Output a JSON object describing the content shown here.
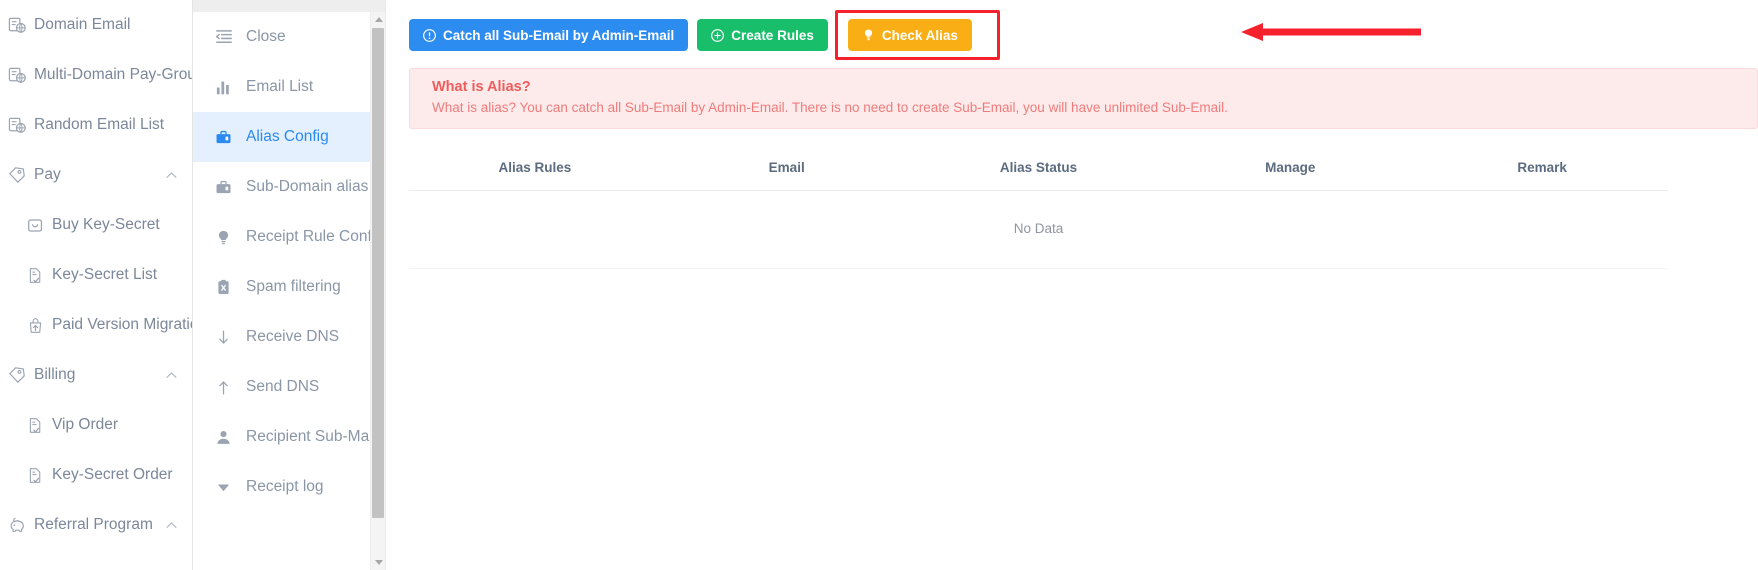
{
  "sidebar": {
    "items": [
      {
        "label": "Domain Email",
        "icon": "domain-email-icon",
        "level": "top",
        "caret": false
      },
      {
        "label": "Multi-Domain Pay-Group",
        "icon": "domain-group-icon",
        "level": "top",
        "caret": false
      },
      {
        "label": "Random Email List",
        "icon": "random-email-icon",
        "level": "top",
        "caret": false
      },
      {
        "label": "Pay",
        "icon": "pay-tag-icon",
        "level": "group",
        "caret": true
      },
      {
        "label": "Buy Key-Secret",
        "icon": "wallet-icon",
        "level": "child",
        "caret": false
      },
      {
        "label": "Key-Secret List",
        "icon": "document-check-icon",
        "level": "child",
        "caret": false
      },
      {
        "label": "Paid Version Migration",
        "icon": "upload-bag-icon",
        "level": "child",
        "caret": false
      },
      {
        "label": "Billing",
        "icon": "pay-tag-icon",
        "level": "group",
        "caret": true
      },
      {
        "label": "Vip Order",
        "icon": "document-check-icon",
        "level": "child",
        "caret": false
      },
      {
        "label": "Key-Secret Order",
        "icon": "document-check-icon",
        "level": "child",
        "caret": false
      },
      {
        "label": "Referral Program",
        "icon": "piggy-bank-icon",
        "level": "group",
        "caret": true
      }
    ]
  },
  "subnav": {
    "items": [
      {
        "label": "Close",
        "icon": "collapse-menu-icon",
        "active": false
      },
      {
        "label": "Email List",
        "icon": "bar-chart-icon",
        "active": false
      },
      {
        "label": "Alias Config",
        "icon": "briefcase-icon",
        "active": true
      },
      {
        "label": "Sub-Domain alias",
        "icon": "briefcase-icon",
        "active": false
      },
      {
        "label": "Receipt Rule Config",
        "icon": "lightbulb-icon",
        "active": false
      },
      {
        "label": "Spam filtering",
        "icon": "clipboard-x-icon",
        "active": false
      },
      {
        "label": "Receive DNS",
        "icon": "arrow-down-icon",
        "active": false
      },
      {
        "label": "Send DNS",
        "icon": "arrow-up-icon",
        "active": false
      },
      {
        "label": "Recipient Sub-Mail",
        "icon": "person-icon",
        "active": false
      },
      {
        "label": "Receipt log",
        "icon": "triangle-down-icon",
        "active": false
      }
    ]
  },
  "toolbar": {
    "catch_all_label": "Catch all Sub-Email by Admin-Email",
    "catch_all_icon": "info-circle-icon",
    "create_rules_label": "Create Rules",
    "create_rules_icon": "plus-circle-icon",
    "check_alias_label": "Check Alias",
    "check_alias_icon": "lightbulb-icon"
  },
  "alert": {
    "title": "What is Alias?",
    "description": "What is alias? You can catch all Sub-Email by Admin-Email. There is no need to create Sub-Email, you will have unlimited Sub-Email."
  },
  "table": {
    "columns": [
      "Alias Rules",
      "Email",
      "Alias Status",
      "Manage",
      "Remark"
    ],
    "rows": [],
    "empty_text": "No Data"
  },
  "annotation": {
    "type": "red-arrow-highlight",
    "target": "Check Alias"
  },
  "colors": {
    "primary": "#2d8cf0",
    "success": "#19be6b",
    "warning": "#f9ae15",
    "alert_bg": "#fdeaea",
    "alert_text": "#ed6f6f",
    "annotation": "#f5222d",
    "active_bg": "#e4f0fd",
    "active_text": "#2a8af0"
  }
}
